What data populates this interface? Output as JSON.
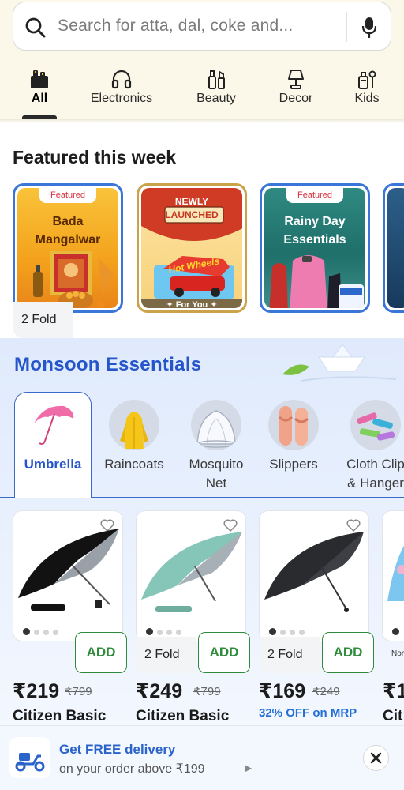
{
  "search": {
    "placeholder": "Search for atta, dal, coke and..."
  },
  "category_tabs": [
    {
      "label": "All",
      "icon": "all-icon",
      "active": true
    },
    {
      "label": "Electronics",
      "icon": "headphones-icon"
    },
    {
      "label": "Beauty",
      "icon": "beauty-icon"
    },
    {
      "label": "Decor",
      "icon": "lamp-icon"
    },
    {
      "label": "Kids",
      "icon": "kids-icon"
    }
  ],
  "featured": {
    "title": "Featured this week",
    "cards": [
      {
        "tag": "Featured",
        "line1": "Bada",
        "line2": "Mangalwar"
      },
      {
        "badge_line1": "NEWLY",
        "badge_line2": "LAUNCHED",
        "brand": "Hot Wheels",
        "footer": "✦ For You ✦"
      },
      {
        "tag": "Featured",
        "line1": "Rainy Day",
        "line2": "Essentials"
      }
    ]
  },
  "monsoon": {
    "title": "Monsoon Essentials",
    "categories": [
      {
        "line1": "Umbrella",
        "line2": "",
        "active": true
      },
      {
        "line1": "Raincoats",
        "line2": ""
      },
      {
        "line1": "Mosquito",
        "line2": "Net"
      },
      {
        "line1": "Slippers",
        "line2": ""
      },
      {
        "line1": "Cloth Clip",
        "line2": "& Hanger"
      }
    ],
    "products": [
      {
        "qty": "2 Fold",
        "add": "ADD",
        "price": "₹219",
        "mrp": "₹799",
        "name": "Citizen Basic",
        "offer": ""
      },
      {
        "qty": "2 Fold",
        "add": "ADD",
        "price": "₹249",
        "mrp": "₹799",
        "name": "Citizen Basic",
        "offer": ""
      },
      {
        "qty": "2 Fold",
        "add": "ADD",
        "price": "₹169",
        "mrp": "₹249",
        "name": "",
        "offer": "32% OFF on MRP"
      },
      {
        "qty": "Nor",
        "price": "₹1",
        "name": "Cit"
      }
    ]
  },
  "delivery_bar": {
    "title": "Get FREE delivery",
    "subtitle": "on your order above ₹199",
    "close_icon": "close-icon"
  },
  "colors": {
    "accent_blue": "#2555c8",
    "add_green": "#2e8b3c",
    "header_bg": "#fbf8e9"
  }
}
